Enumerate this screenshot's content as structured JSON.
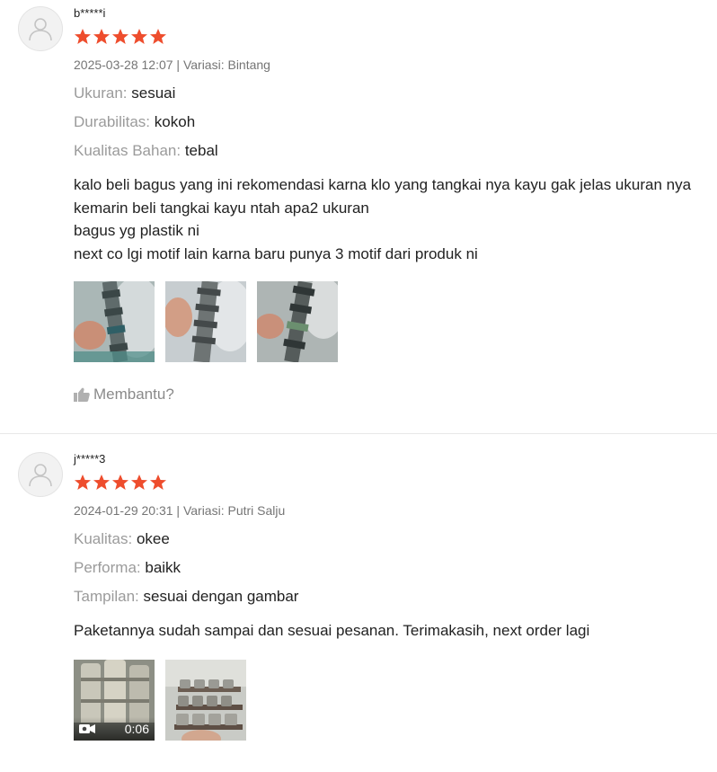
{
  "colors": {
    "star": "#ee4d2d",
    "label": "#9b9b9b",
    "meta": "#757575",
    "text": "#222222",
    "divider": "#e8e8e8"
  },
  "reviews": [
    {
      "username": "b*****i",
      "rating": 5,
      "meta": "2025-03-28 12:07 | Variasi: Bintang",
      "attributes": [
        {
          "label": "Ukuran:",
          "value": "sesuai"
        },
        {
          "label": "Durabilitas:",
          "value": "kokoh"
        },
        {
          "label": "Kualitas Bahan:",
          "value": "tebal"
        }
      ],
      "comment_lines": [
        "kalo beli bagus yang ini rekomendasi karna klo yang tangkai nya kayu gak jelas ukuran nya",
        "kemarin beli tangkai kayu ntah apa2 ukuran",
        "bagus yg plastik ni",
        "next co lgi motif lain karna baru punya 3 motif dari produk ni"
      ],
      "media_count": 3,
      "helpful_label": "Membantu?"
    },
    {
      "username": "j*****3",
      "rating": 5,
      "meta": "2024-01-29 20:31 | Variasi: Putri Salju",
      "attributes": [
        {
          "label": "Kualitas:",
          "value": "okee"
        },
        {
          "label": "Performa:",
          "value": "baikk"
        },
        {
          "label": "Tampilan:",
          "value": "sesuai dengan gambar"
        }
      ],
      "comment_lines": [
        "Paketannya sudah sampai dan sesuai pesanan. Terimakasih, next order lagi"
      ],
      "media_count": 2,
      "video_duration": "0:06"
    }
  ],
  "icons": {
    "avatar": "user-silhouette-icon",
    "star": "star-icon",
    "helpful": "thumbs-up-icon",
    "video": "video-camera-icon"
  }
}
